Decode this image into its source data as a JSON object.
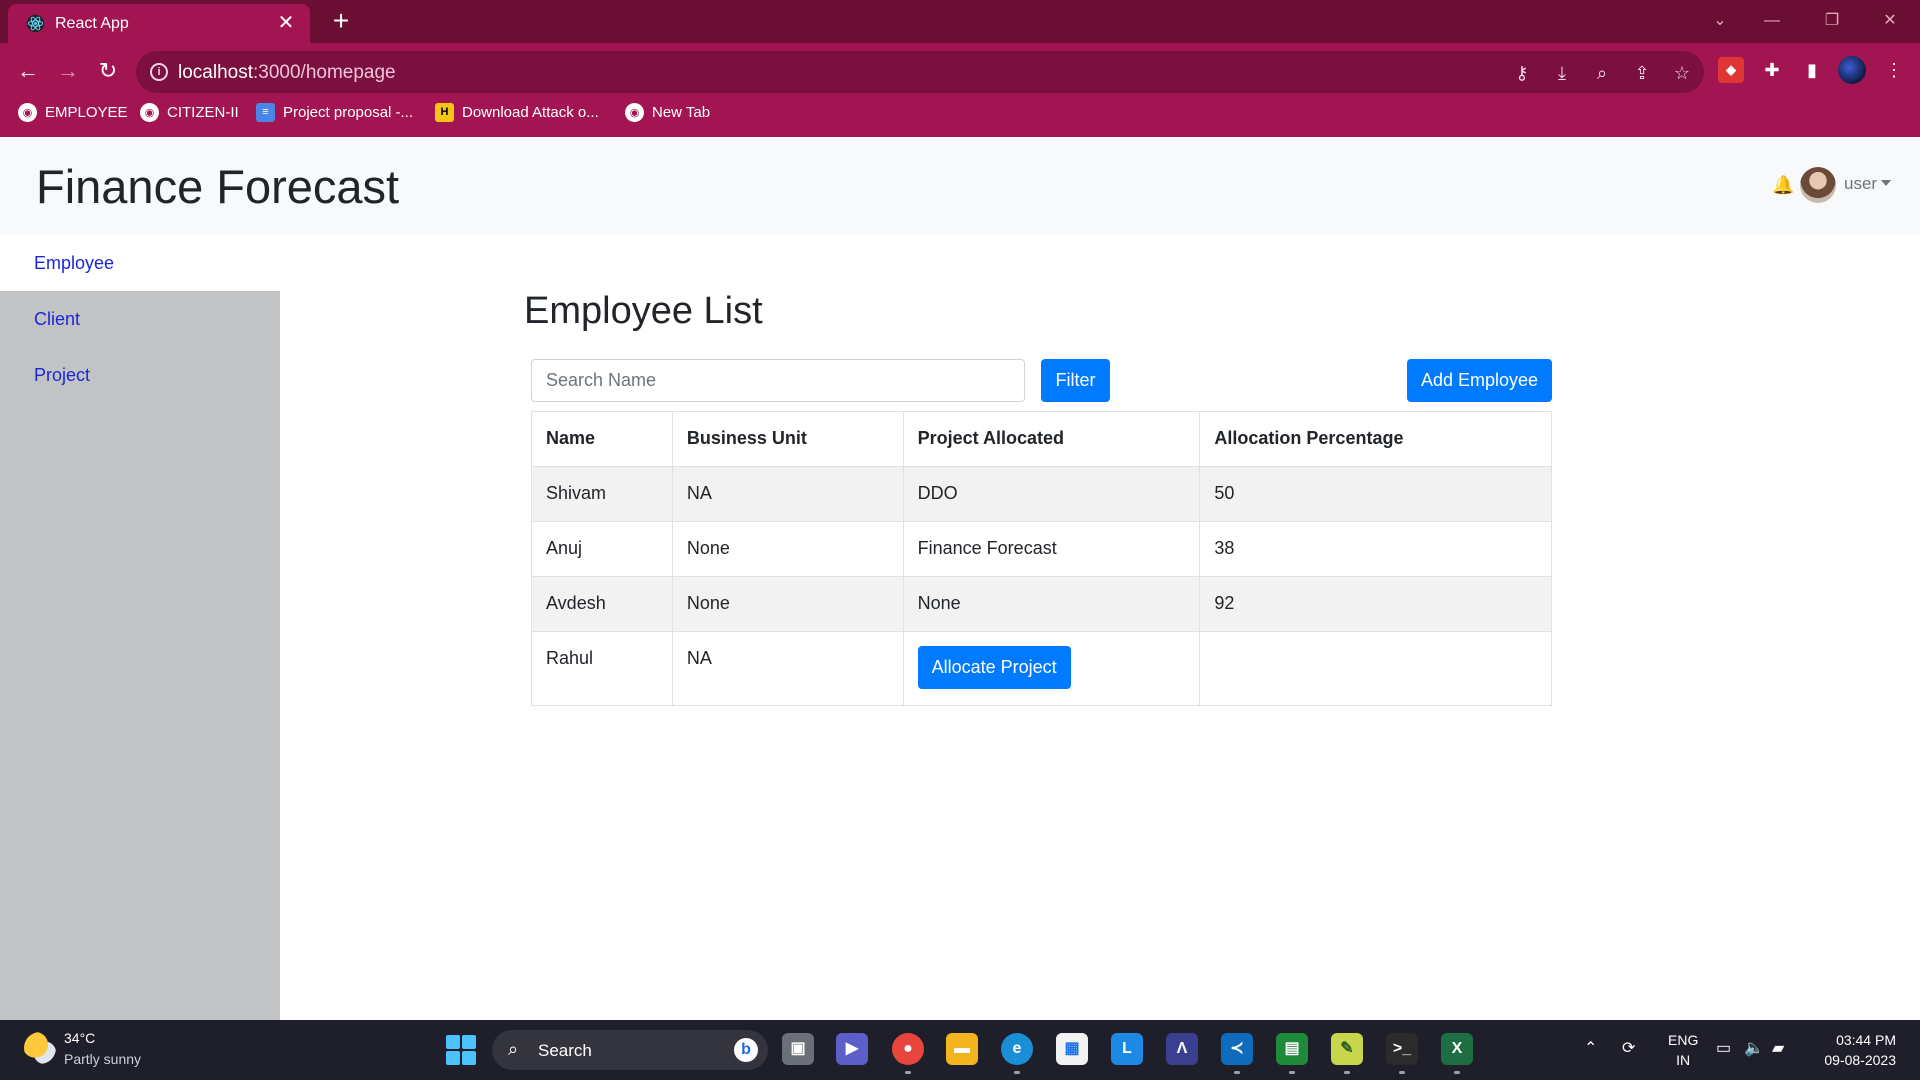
{
  "browser": {
    "tab_title": "React App",
    "url_host": "localhost",
    "url_rest": ":3000/homepage",
    "accent": "#a31552",
    "bookmarks": [
      {
        "label": "EMPLOYEE",
        "icon": "globe-icon"
      },
      {
        "label": "CITIZEN-II",
        "icon": "globe-icon"
      },
      {
        "label": "Project proposal -...",
        "icon": "google-docs-icon"
      },
      {
        "label": "Download Attack o...",
        "icon": "yellow-bookmark-icon"
      },
      {
        "label": "New Tab",
        "icon": "globe-icon"
      }
    ]
  },
  "app": {
    "title": "Finance Forecast",
    "user_label": "user",
    "sidebar": [
      {
        "label": "Employee",
        "active": true
      },
      {
        "label": "Client",
        "active": false
      },
      {
        "label": "Project",
        "active": false
      }
    ],
    "page_title": "Employee List",
    "search_placeholder": "Search Name",
    "filter_label": "Filter",
    "add_label": "Add Employee",
    "primary_color": "#007bff",
    "table": {
      "headers": [
        "Name",
        "Business Unit",
        "Project Allocated",
        "Allocation Percentage"
      ],
      "rows": [
        {
          "name": "Shivam",
          "unit": "NA",
          "project": "DDO",
          "percent": "50"
        },
        {
          "name": "Anuj",
          "unit": "None",
          "project": "Finance Forecast",
          "percent": "38"
        },
        {
          "name": "Avdesh",
          "unit": "None",
          "project": "None",
          "percent": "92"
        },
        {
          "name": "Rahul",
          "unit": "NA",
          "project": "",
          "percent": ""
        }
      ],
      "allocate_label": "Allocate Project"
    }
  },
  "taskbar": {
    "temperature": "34°C",
    "condition": "Partly sunny",
    "search_label": "Search",
    "lang_top": "ENG",
    "lang_bottom": "IN",
    "time": "03:44 PM",
    "date": "09-08-2023"
  }
}
